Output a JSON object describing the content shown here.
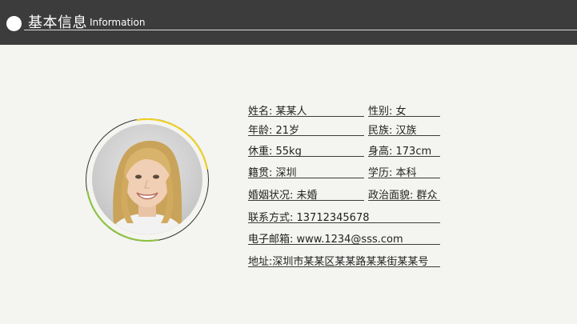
{
  "header": {
    "title": "基本信息",
    "subtitle": "Information"
  },
  "profile": {
    "photo_icon": "person-photo"
  },
  "fields": {
    "name": "姓名: 某某人",
    "gender": "性别: 女",
    "age": "年龄: 21岁",
    "ethnicity": "民族: 汉族",
    "weight": "休重: 55kg",
    "height": "身高: 173cm",
    "native_place": "籍贯: 深圳",
    "education": "学历: 本科",
    "marital": "婚姻状况: 未婚",
    "political": "政治面貌: 群众",
    "phone": "联系方式: 13712345678",
    "email": "电子邮箱: www.1234@sss.com",
    "address": "地址:深圳市某某区某某路某某街某某号"
  },
  "colors": {
    "header_bg": "#3c3c3c",
    "page_bg": "#f4f4f0",
    "accent_yellow": "#f1d21f",
    "accent_green": "#8cc63f"
  }
}
